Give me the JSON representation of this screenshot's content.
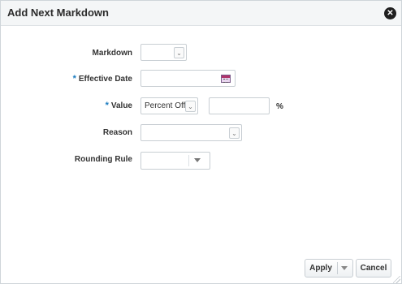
{
  "dialog": {
    "title": "Add Next Markdown",
    "close_icon": "close-icon"
  },
  "form": {
    "markdown": {
      "label": "Markdown",
      "value": ""
    },
    "effective_date": {
      "label": "Effective Date",
      "required_marker": "*",
      "value": "",
      "icon": "calendar-icon"
    },
    "value": {
      "label": "Value",
      "required_marker": "*",
      "type_selected": "Percent Off",
      "amount": "",
      "unit": "%"
    },
    "reason": {
      "label": "Reason",
      "value": ""
    },
    "rounding_rule": {
      "label": "Rounding Rule",
      "value": ""
    }
  },
  "footer": {
    "apply_label": "Apply",
    "cancel_label": "Cancel"
  },
  "colors": {
    "header_bg": "#f4f6f7",
    "required_marker": "#1a7bbf",
    "border": "#c8ced3"
  }
}
